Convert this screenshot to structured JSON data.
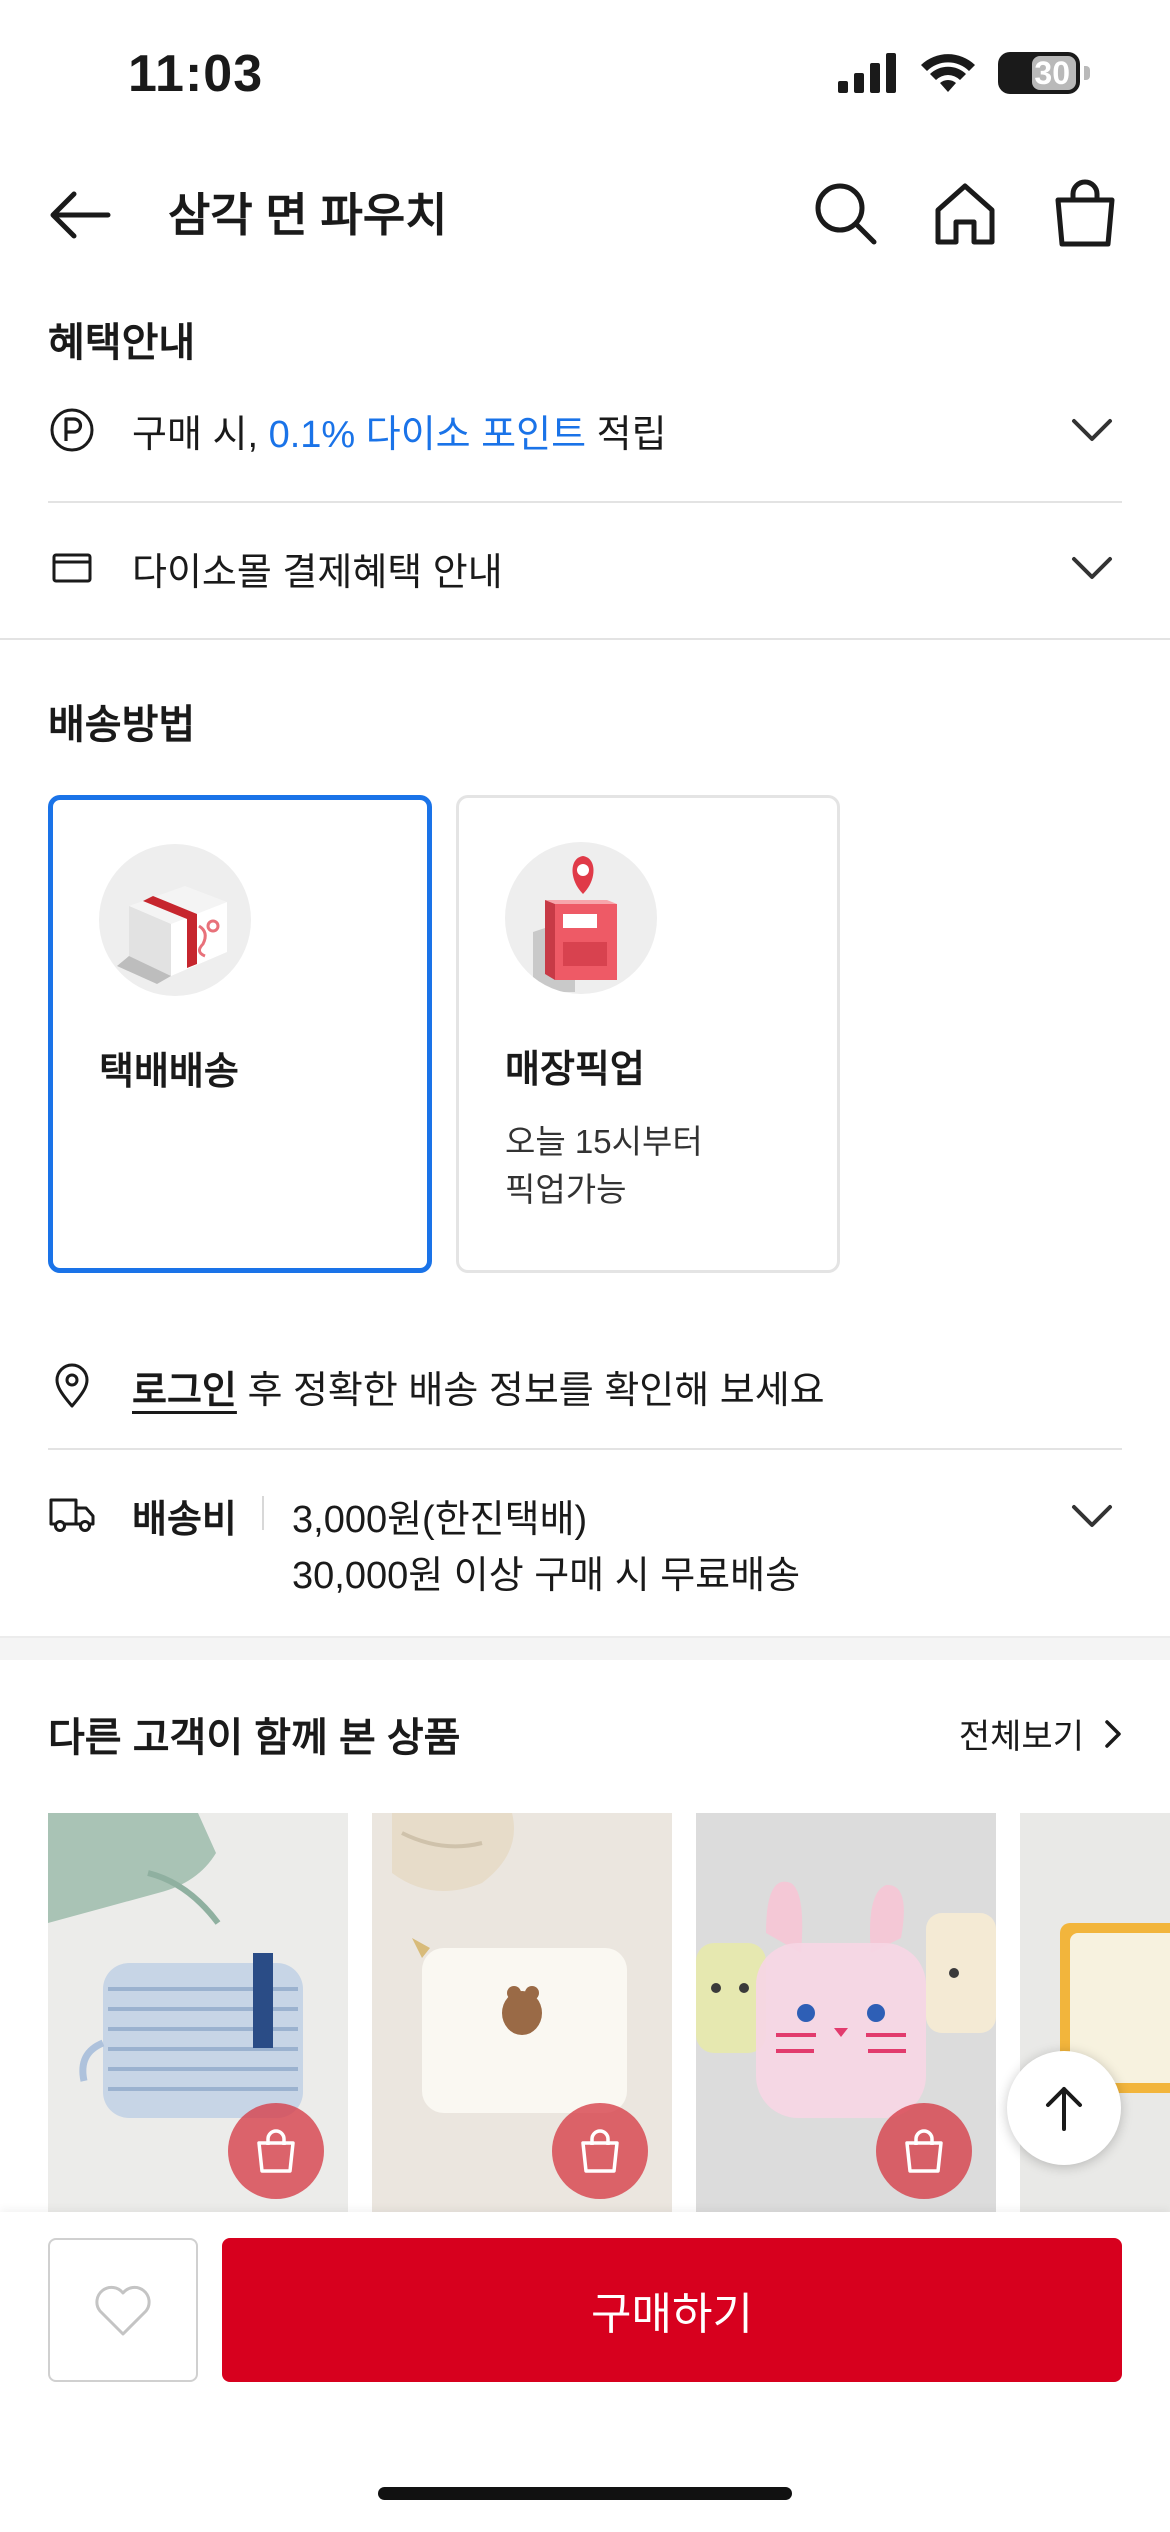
{
  "status_bar": {
    "time": "11:03",
    "battery": "30"
  },
  "header": {
    "title": "삼각 면 파우치"
  },
  "benefits": {
    "section_title": "혜택안내",
    "point_prefix": "구매 시, ",
    "point_highlight": "0.1% 다이소 포인트",
    "point_suffix": " 적립",
    "payment_text": "다이소몰 결제혜택 안내"
  },
  "shipping": {
    "section_title": "배송방법",
    "options": [
      {
        "label": "택배배송",
        "sub": ""
      },
      {
        "label": "매장픽업",
        "sub": "오늘 15시부터\n픽업가능"
      }
    ],
    "login_link": "로그인",
    "login_suffix": " 후 정확한 배송 정보를 확인해 보세요",
    "fee_label": "배송비",
    "fee_line1": "3,000원(한진택배)",
    "fee_line2": "30,000원 이상 구매 시 무료배송"
  },
  "recommended": {
    "section_title": "다른 고객이 함께 본 상품",
    "view_all": "전체보기"
  },
  "bottom": {
    "buy_label": "구매하기"
  },
  "colors": {
    "accent_blue": "#1a73e8",
    "brand_red": "#d7001e"
  }
}
